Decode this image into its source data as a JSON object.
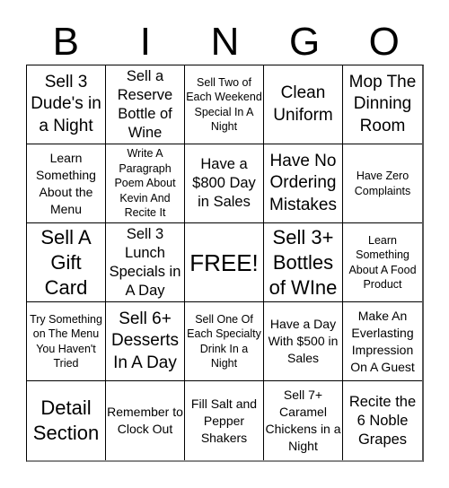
{
  "header": {
    "letters": [
      "B",
      "I",
      "N",
      "G",
      "O"
    ]
  },
  "board": {
    "cells": [
      "Sell 3 Dude's in a Night",
      "Sell a Reserve Bottle of Wine",
      "Sell Two of Each Weekend Special In A Night",
      "Clean Uniform",
      "Mop The Dinning Room",
      "Learn Something About the Menu",
      "Write A Paragraph Poem About Kevin And Recite It",
      "Have a $800 Day in Sales",
      "Have No Ordering Mistakes",
      "Have Zero Complaints",
      "Sell A Gift Card",
      "Sell 3 Lunch Specials in A Day",
      "FREE!",
      "Sell 3+ Bottles of WIne",
      "Learn Something About A Food Product",
      "Try Something on The Menu You Haven't Tried",
      "Sell 6+ Desserts In A Day",
      "Sell One Of Each Specialty Drink In a Night",
      "Have a Day With $500 in Sales",
      "Make An Everlasting Impression On A Guest",
      "Detail Section",
      "Remember to Clock Out",
      "Fill Salt and Pepper Shakers",
      "Sell 7+ Caramel Chickens in a Night",
      "Recite the 6 Noble Grapes"
    ]
  }
}
